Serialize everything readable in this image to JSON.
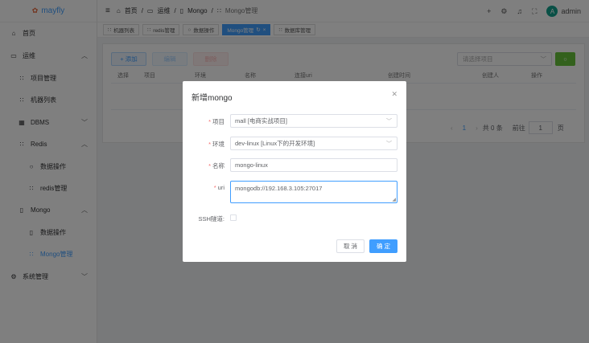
{
  "app": {
    "name": "mayfly"
  },
  "sidebar": {
    "items": [
      {
        "label": "首页",
        "icon": "home-icon"
      },
      {
        "label": "运维",
        "icon": "monitor-icon"
      },
      {
        "label": "项目管理",
        "icon": "grid-icon"
      },
      {
        "label": "机器列表",
        "icon": "grid-icon"
      },
      {
        "label": "DBMS",
        "icon": "grid-icon"
      },
      {
        "label": "Redis",
        "icon": "grid-icon"
      },
      {
        "label": "数据操作",
        "icon": "search-icon"
      },
      {
        "label": "redis管理",
        "icon": "grid-icon"
      },
      {
        "label": "Mongo",
        "icon": "document-icon"
      },
      {
        "label": "数据操作",
        "icon": "document-icon"
      },
      {
        "label": "Mongo管理",
        "icon": "grid-icon"
      },
      {
        "label": "系统管理",
        "icon": "gear-icon"
      }
    ]
  },
  "header": {
    "breadcrumb": [
      "首页",
      "运维",
      "Mongo",
      "Mongo管理"
    ],
    "user": "admin",
    "avatar_letter": "A"
  },
  "tabs": [
    {
      "label": "机器列表"
    },
    {
      "label": "redis管理"
    },
    {
      "label": "数据操作"
    },
    {
      "label": "Mongo管理"
    },
    {
      "label": "数据库管理"
    }
  ],
  "toolbar": {
    "add": "+ 添加",
    "edit": "编辑",
    "delete": "删除",
    "project_placeholder": "请选择项目"
  },
  "table": {
    "columns": [
      "选择",
      "项目",
      "环境",
      "名称",
      "连接uri",
      "创建时间",
      "创建人",
      "操作"
    ]
  },
  "pagination": {
    "current": "1",
    "total": "共 0 条",
    "goto": "前往",
    "page_input": "1",
    "page_suffix": "页"
  },
  "dialog": {
    "title": "新增mongo",
    "fields": [
      {
        "label": "项目",
        "value": "mall [电商实战项目]"
      },
      {
        "label": "环境",
        "value": "dev-linux [Linux下的开发环境]"
      },
      {
        "label": "名称",
        "value": "mongo-linux"
      },
      {
        "label": "uri",
        "value": "mongodb://192.168.3.105:27017"
      }
    ],
    "ssh_label": "SSH隧道:",
    "cancel": "取 消",
    "confirm": "确 定"
  }
}
